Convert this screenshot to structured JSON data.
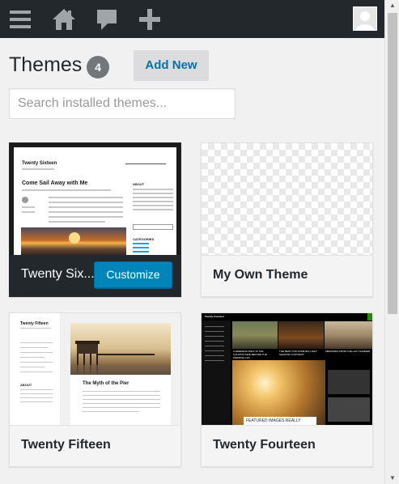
{
  "adminbar": {
    "icons": [
      "menu-icon",
      "home-icon",
      "comment-icon",
      "plus-icon",
      "avatar"
    ]
  },
  "header": {
    "title": "Themes",
    "count": "4",
    "add_new_label": "Add New"
  },
  "search": {
    "placeholder": "Search installed themes..."
  },
  "themes": [
    {
      "name": "Twenty Six...",
      "active": true,
      "action_label": "Customize",
      "preview": {
        "site_title": "Twenty Sixteen",
        "post_title": "Come Sail Away with Me",
        "nav": [
          "Home",
          "Right Sidebar",
          "Blog",
          "Contact"
        ],
        "sidebar_heading": "ABOUT",
        "categories_heading": "CATEGORIES"
      }
    },
    {
      "name": "My Own Theme",
      "active": false
    },
    {
      "name": "Twenty Fifteen",
      "active": false,
      "preview": {
        "site_title": "Twenty Fifteen",
        "post_title": "The Myth of the Pier",
        "sidebar_heading": "ABOUT"
      }
    },
    {
      "name": "Twenty Fourteen",
      "active": false,
      "preview": {
        "site_title": "Twenty Fourteen",
        "featured_label": "FEATURED IMAGES REALLY",
        "caption_1": "A WEEKEND AWAY IN THE COUNTRYSIDE BEFORE THE WEDDING DAY",
        "caption_2": "THE BEST FOR SOME BIG LIGHT SHADOW CONTRAST",
        "caption_3": "MEMORIES FROM THE LAST SUMMER"
      }
    }
  ],
  "colors": {
    "adminbar": "#23282d",
    "accent": "#0085ba",
    "link": "#0073aa",
    "badge": "#72777c",
    "background": "#f1f1f1"
  }
}
